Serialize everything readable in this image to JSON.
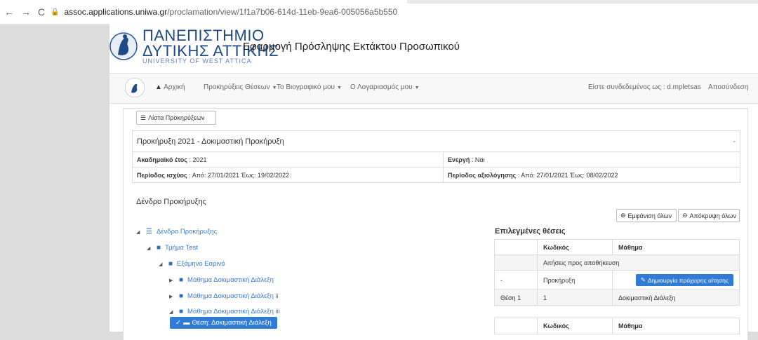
{
  "browser": {
    "back_icon": "arrow-left",
    "forward_icon": "arrow-right",
    "reload_icon": "reload",
    "url_host": "assoc.applications.uniwa.gr",
    "url_path": "/proclamation/view/1f1a7b06-614d-11eb-9ea6-005056a5b550"
  },
  "header": {
    "uni_line1": "ΠΑΝΕΠΙΣΤΗΜΙΟ",
    "uni_line2": "ΔΥΤΙΚΗΣ ΑΤΤΙΚΗΣ",
    "uni_line3": "UNIVERSITY OF WEST ATTICA",
    "app_title": "Εφαρμογή Πρόσληψης Εκτάκτου Προσωπικού"
  },
  "navbar": {
    "home": "Αρχική",
    "proclamations": "Προκηρύξεις Θέσεων",
    "cv": "Το Βιογραφικό μου",
    "account": "Ο Λογαριασμός μου",
    "logged_in": "Είστε συνδεδεμένος ως : d.mpletsas",
    "logout": "Αποσύνδεση"
  },
  "main": {
    "list_button": "Λίστα Προκηρύξεων",
    "proclamation_title": "Προκήρυξη 2021 - Δοκιμαστική Προκήρυξη",
    "collapse_sign": "-",
    "academic_year_label": "Ακαδημαϊκό έτος",
    "academic_year_value": ": 2021",
    "active_label": "Ενεργή",
    "active_value": ": Ναι",
    "validity_label": "Περίοδος ισχύος",
    "validity_value": ": Από: 27/01/2021 Έως: 19/02/2022",
    "evaluation_label": "Περίοδος αξιολόγησης",
    "evaluation_value": ": Από: 27/01/2021 Έως: 08/02/2022",
    "tree_heading": "Δένδρο Προκήρυξης",
    "show_all": "Εμφάνιση όλων",
    "hide_all": "Απόκρυψη όλων"
  },
  "tree": {
    "root": "Δένδρο Προκήρυξης",
    "department": "Τμήμα Test",
    "semester": "Εξάμηνο Εαρινό",
    "course1": "Μάθημα Δοκιμαστική Διάλεξη",
    "course2": "Μάθημα Δοκιμαστική Διάλεξη ii",
    "course3": "Μάθημα Δοκιμαστική Διάλεξη iii",
    "selected_position": "Θέση: Δοκιμαστική Διάλεξη"
  },
  "selected": {
    "heading": "Επιλεγμένες θέσεις",
    "col_code": "Κωδικός",
    "col_course": "Μάθημα",
    "saved_applications": "Αιτήσεις προς αποθήκευση",
    "row1_col1": "-",
    "row1_col2": "Προκήρυξη",
    "create_draft": "Δημιουργία πρόχειρης αίτησης",
    "row2_col1": "Θέση 1",
    "row2_col2": "1",
    "row2_col3": "Δοκιμαστική Διάλεξη"
  }
}
